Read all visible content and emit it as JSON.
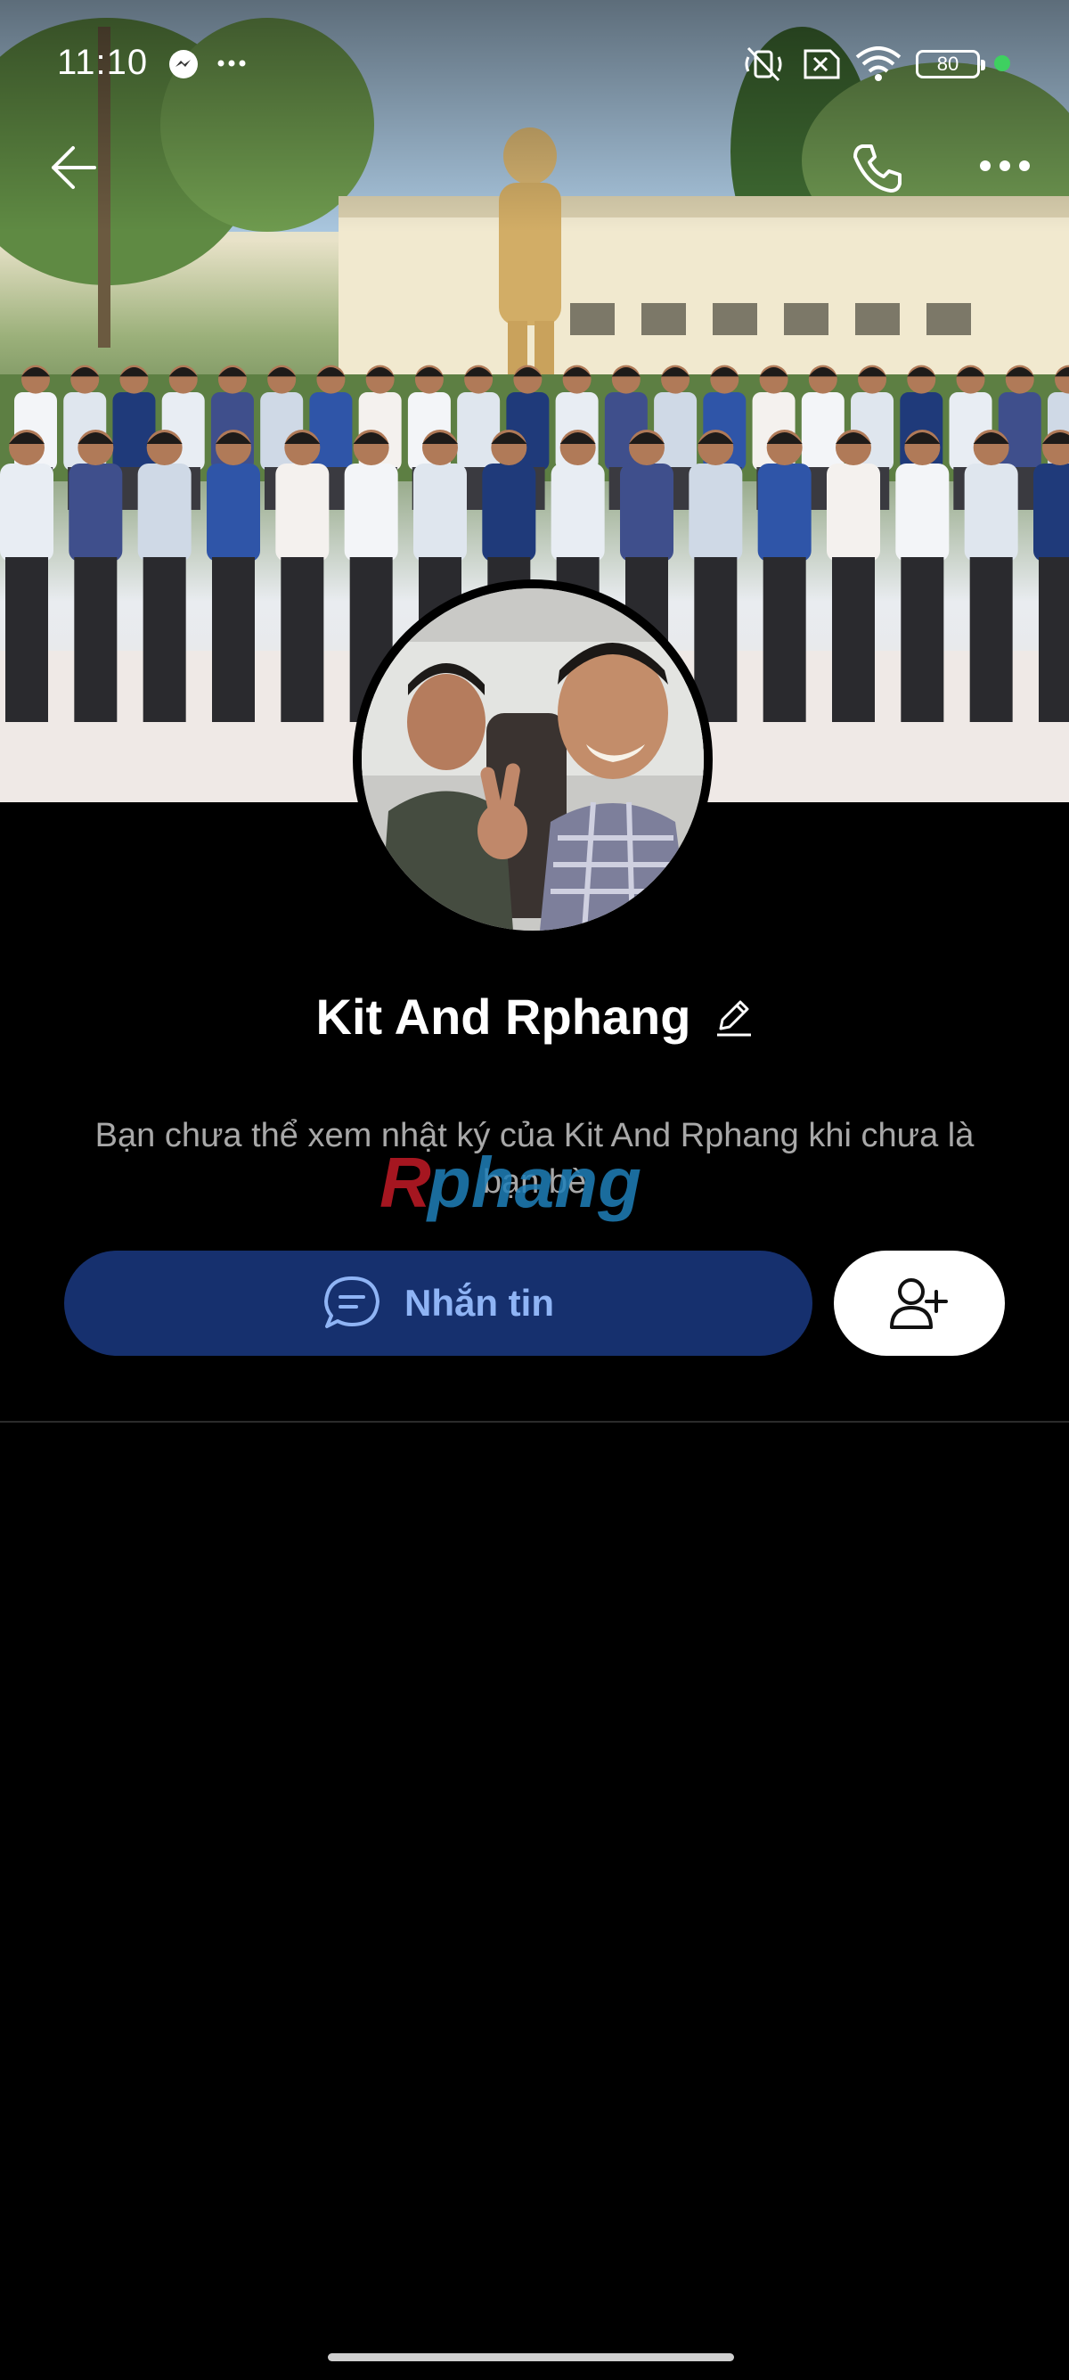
{
  "status_bar": {
    "time": "11:10",
    "battery": "80",
    "icons": [
      "messenger-icon",
      "more-notifications-icon",
      "mute-icon",
      "sim-off-icon",
      "wifi-icon",
      "battery-icon"
    ]
  },
  "nav": {
    "back_icon": "back-arrow-icon",
    "call_icon": "phone-icon",
    "more_icon": "more-options-icon"
  },
  "profile": {
    "name": "Kit And Rphang",
    "privacy_message": "Bạn chưa thể xem nhật ký của Kit And Rphang khi chưa là bạn bè",
    "watermark": "Rphang"
  },
  "actions": {
    "message_label": "Nhắn tin",
    "message_icon": "chat-bubble-icon",
    "add_friend_icon": "add-friend-icon"
  },
  "colors": {
    "background": "#000000",
    "message_button_bg": "#16306e",
    "message_button_text": "#8fb4f5",
    "privacy_text": "#a8a8a8",
    "status_dot": "#3ed060"
  }
}
